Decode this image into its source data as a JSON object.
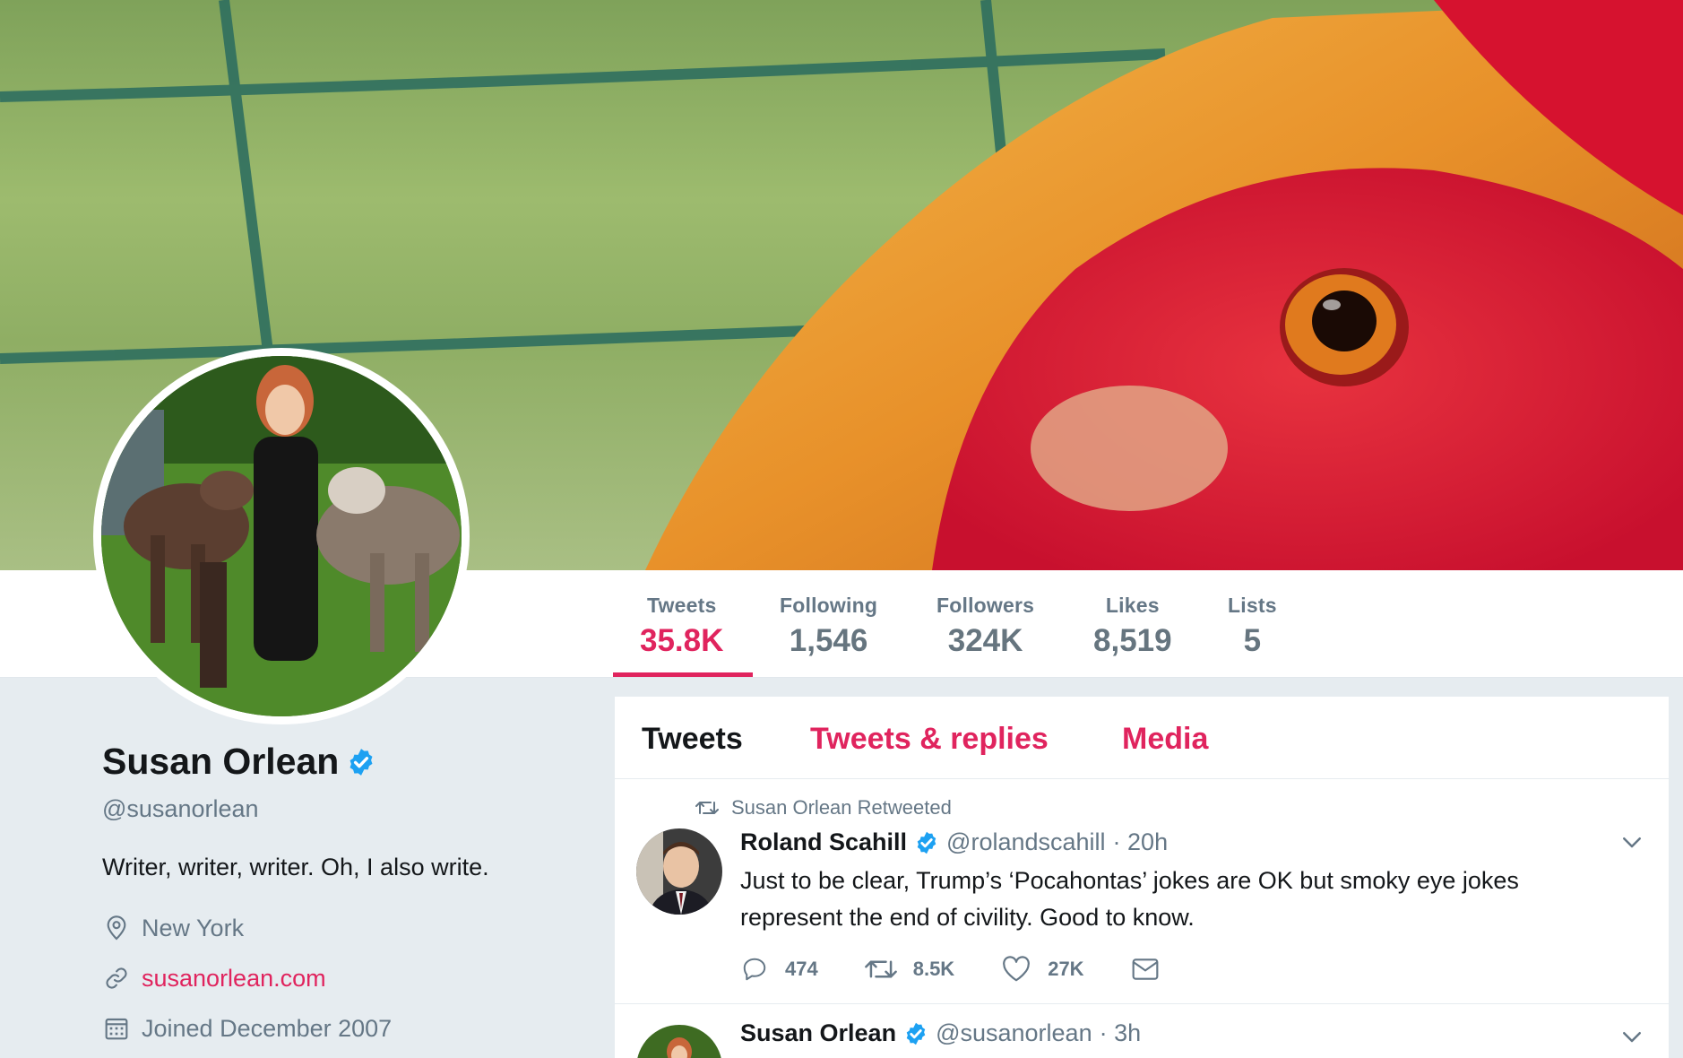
{
  "stats": [
    {
      "label": "Tweets",
      "value": "35.8K"
    },
    {
      "label": "Following",
      "value": "1,546"
    },
    {
      "label": "Followers",
      "value": "324K"
    },
    {
      "label": "Likes",
      "value": "8,519"
    },
    {
      "label": "Lists",
      "value": "5"
    }
  ],
  "profile": {
    "name": "Susan Orlean",
    "handle": "@susanorlean",
    "bio": "Writer, writer, writer. Oh, I also write.",
    "location": "New York",
    "website": "susanorlean.com",
    "joined": "Joined December 2007"
  },
  "tabs": [
    "Tweets",
    "Tweets & replies",
    "Media"
  ],
  "tweets": [
    {
      "context": "Susan Orlean Retweeted",
      "name": "Roland Scahill",
      "handle": "@rolandscahill",
      "time": "· 20h",
      "text": "Just to be clear, Trump’s ‘Pocahontas’ jokes are OK but smoky eye jokes represent the end of civility. Good to know.",
      "replies": "474",
      "retweets": "8.5K",
      "likes": "27K"
    },
    {
      "name": "Susan Orlean",
      "handle": "@susanorlean",
      "time": "· 3h"
    }
  ],
  "colors": {
    "accent": "#e0245e",
    "verified": "#1da1f2",
    "text": "#14171a",
    "muted": "#657786",
    "background": "#e6ecf0"
  }
}
